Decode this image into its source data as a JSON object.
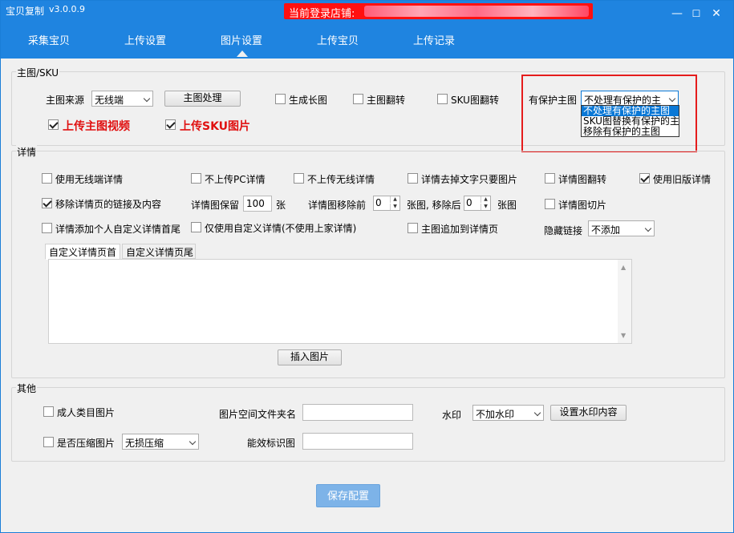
{
  "titlebar": {
    "app_title": "宝贝复制",
    "version": "v3.0.0.9",
    "shop_label": "当前登录店铺:",
    "min_icon": "—",
    "max_icon": "☐",
    "close_icon": "✕"
  },
  "nav": {
    "tabs": [
      "采集宝贝",
      "上传设置",
      "图片设置",
      "上传宝贝",
      "上传记录"
    ],
    "active": "图片设置"
  },
  "main_sku": {
    "group_title": "主图/SKU",
    "source_label": "主图来源",
    "source_value": "无线端",
    "process_button": "主图处理",
    "gen_long": "生成长图",
    "gen_long_checked": false,
    "flip_main": "主图翻转",
    "flip_main_checked": false,
    "flip_sku": "SKU图翻转",
    "flip_sku_checked": false,
    "protected_label": "有保护主图",
    "protected_value": "不处理有保护的主",
    "protected_options": [
      "不处理有保护的主图",
      "SKU图替换有保护的主图",
      "移除有保护的主图"
    ],
    "upload_video": "上传主图视频",
    "upload_video_checked": true,
    "upload_sku": "上传SKU图片",
    "upload_sku_checked": true
  },
  "detail": {
    "group_title": "详情",
    "use_wireless": "使用无线端详情",
    "use_wireless_checked": false,
    "no_pc": "不上传PC详情",
    "no_pc_checked": false,
    "no_wireless": "不上传无线详情",
    "no_wireless_checked": false,
    "remove_text": "详情去掉文字只要图片",
    "remove_text_checked": false,
    "flip_detail": "详情图翻转",
    "flip_detail_checked": false,
    "use_old": "使用旧版详情",
    "use_old_checked": true,
    "remove_links": "移除详情页的链接及内容",
    "remove_links_checked": true,
    "keep_label": "详情图保留",
    "keep_value": "100",
    "keep_unit": "张",
    "remove_front_label": "详情图移除前",
    "remove_front_value": "0",
    "remove_mid": "张图, 移除后",
    "remove_back_value": "0",
    "remove_back_unit": "张图",
    "slice": "详情图切片",
    "slice_checked": false,
    "add_header": "详情添加个人自定义详情首尾",
    "add_header_checked": false,
    "only_custom": "仅使用自定义详情(不使用上家详情)",
    "only_custom_checked": false,
    "append_main": "主图追加到详情页",
    "append_main_checked": false,
    "hide_link_label": "隐藏链接",
    "hide_link_value": "不添加",
    "tab_head": "自定义详情页首",
    "tab_tail": "自定义详情页尾",
    "insert_button": "插入图片"
  },
  "other": {
    "group_title": "其他",
    "adult": "成人类目图片",
    "adult_checked": false,
    "folder_label": "图片空间文件夹名",
    "watermark_label": "水印",
    "watermark_value": "不加水印",
    "watermark_button": "设置水印内容",
    "compress": "是否压缩图片",
    "compress_checked": false,
    "compress_value": "无损压缩",
    "efficacy_label": "能效标识图"
  },
  "save_button": "保存配置",
  "colors": {
    "titlebar": "#1f84e0",
    "highlight": "#e51c1c",
    "shop_banner": "#ff1010",
    "save_button": "#7db3e8"
  }
}
